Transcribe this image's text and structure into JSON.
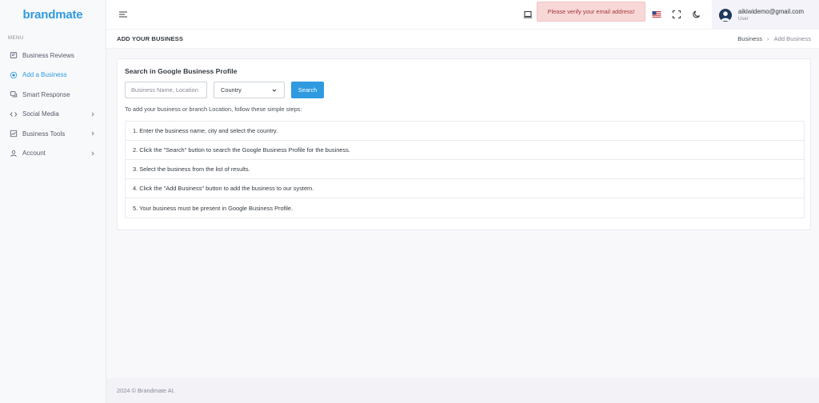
{
  "brand": "brandmate",
  "sidebar": {
    "menu_title": "MENU",
    "items": [
      {
        "label": "Business Reviews",
        "icon": "reviews-icon"
      },
      {
        "label": "Add a Business",
        "icon": "plus-circle-icon"
      },
      {
        "label": "Smart Response",
        "icon": "chat-icon"
      },
      {
        "label": "Social Media",
        "icon": "code-icon"
      },
      {
        "label": "Business Tools",
        "icon": "chart-icon"
      },
      {
        "label": "Account",
        "icon": "user-icon"
      }
    ]
  },
  "topbar": {
    "verify_message": "Please verify your email address!",
    "user_email": "aikiwidemo@gmail.com",
    "user_role": "User"
  },
  "page": {
    "title": "ADD YOUR BUSINESS",
    "breadcrumb": [
      "Business",
      "Add Business"
    ]
  },
  "search": {
    "card_title": "Search in Google Business Profile",
    "placeholder": "Business Name, Location",
    "country_label": "Country",
    "button_label": "Search",
    "instructions": "To add your business or branch Location, follow these simple steps:",
    "steps": [
      "1. Enter the business name, city and select the country.",
      "2. Click the \"Search\" button to search the Google Business Profile for the business.",
      "3. Select the business from the list of results.",
      "4. Click the \"Add Business\" button to add the business to our system.",
      "5. Your business must be present in Google Business Profile."
    ]
  },
  "footer": "2024 © Brandmate AI.",
  "colors": {
    "accent": "#2f9ae0",
    "alert_bg": "#f8d7d7",
    "alert_text": "#a33a3a"
  }
}
